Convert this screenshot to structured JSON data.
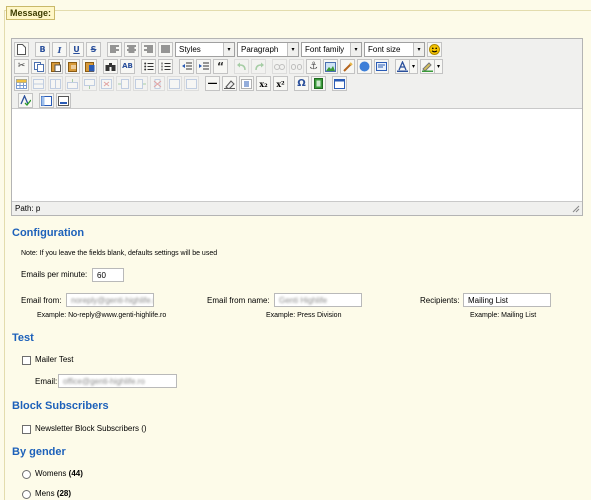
{
  "legend": "Message:",
  "editor": {
    "selects": {
      "styles": "Styles",
      "paragraph": "Paragraph",
      "font_family": "Font family",
      "font_size": "Font size"
    },
    "glyphs": {
      "bold": "B",
      "italic": "I",
      "underline": "U",
      "strike": "S",
      "quote": "“",
      "subscript": "x₂",
      "superscript": "x²",
      "omega": "Ω",
      "cut": "✂",
      "anchor": "⚓",
      "help": "?",
      "hr": "—",
      "arrow": "▾"
    },
    "status_path": "Path: p"
  },
  "configuration": {
    "title": "Configuration",
    "note": "Note: If you leave the fields blank, defaults settings will be used",
    "emails_per_minute_label": "Emails per minute:",
    "emails_per_minute_value": "60",
    "email_from_label": "Email from:",
    "email_from_value": "noreply@genti-highlife.ro",
    "email_from_example": "Example: No-reply@www.genti-highlife.ro",
    "email_from_name_label": "Email from name:",
    "email_from_name_value": "Genti Highlife",
    "email_from_name_example": "Example: Press Division",
    "recipients_label": "Recipients:",
    "recipients_value": "Mailing List",
    "recipients_example": "Example: Mailing List"
  },
  "test": {
    "title": "Test",
    "mailer_test_label": "Mailer Test",
    "email_label": "Email:",
    "email_value": "office@genti-highlife.ro"
  },
  "block": {
    "title": "Block Subscribers",
    "newsletter_label": "Newsletter Block Subscribers ()"
  },
  "gender": {
    "title": "By gender",
    "womens_label": "Womens",
    "womens_count": "(44)",
    "mens_label": "Mens",
    "mens_count": "(28)"
  }
}
